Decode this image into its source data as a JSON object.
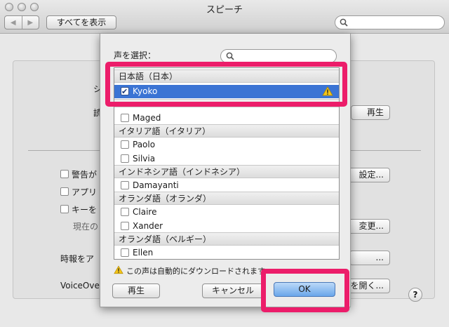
{
  "window": {
    "title": "スピーチ",
    "nav_back": "◀",
    "nav_forward": "▶",
    "show_all_label": "すべてを表示",
    "search_placeholder": ""
  },
  "background": {
    "label_s": "シ",
    "label_read": "読",
    "play_button": "再生",
    "check_warning": "警告が",
    "check_app": "アプリ",
    "check_key": "キーを",
    "current_prefix": "現在の",
    "settings_button_tail": "設定...",
    "change_button_tail": "変更...",
    "clock_label": "時報をア",
    "clock_button_tail": "...",
    "voiceover_label": "VoiceOver",
    "voiceover_button_tail": "を開く...",
    "help_label": "?"
  },
  "sheet": {
    "voice_select_label": "声を選択：",
    "search_placeholder": "",
    "rows": [
      {
        "type": "header",
        "label": "日本語（日本）"
      },
      {
        "type": "item",
        "label": "Kyoko",
        "checked": true,
        "selected": true,
        "warning": true
      },
      {
        "type": "item",
        "label": "Maged",
        "checked": false
      },
      {
        "type": "header",
        "label": "イタリア語（イタリア）"
      },
      {
        "type": "item",
        "label": "Paolo",
        "checked": false
      },
      {
        "type": "item",
        "label": "Silvia",
        "checked": false
      },
      {
        "type": "header",
        "label": "インドネシア語（インドネシア）"
      },
      {
        "type": "item",
        "label": "Damayanti",
        "checked": false
      },
      {
        "type": "header",
        "label": "オランダ語（オランダ）"
      },
      {
        "type": "item",
        "label": "Claire",
        "checked": false
      },
      {
        "type": "item",
        "label": "Xander",
        "checked": false
      },
      {
        "type": "header",
        "label": "オランダ語（ベルギー）"
      },
      {
        "type": "item",
        "label": "Ellen",
        "checked": false
      }
    ],
    "notice": "この声は自動的にダウンロードされます",
    "play_button": "再生",
    "cancel_button": "キャンセル",
    "ok_button": "OK"
  },
  "colors": {
    "highlight": "#ec1d6a",
    "selection": "#3b74d4",
    "warning": "#f5c518"
  }
}
